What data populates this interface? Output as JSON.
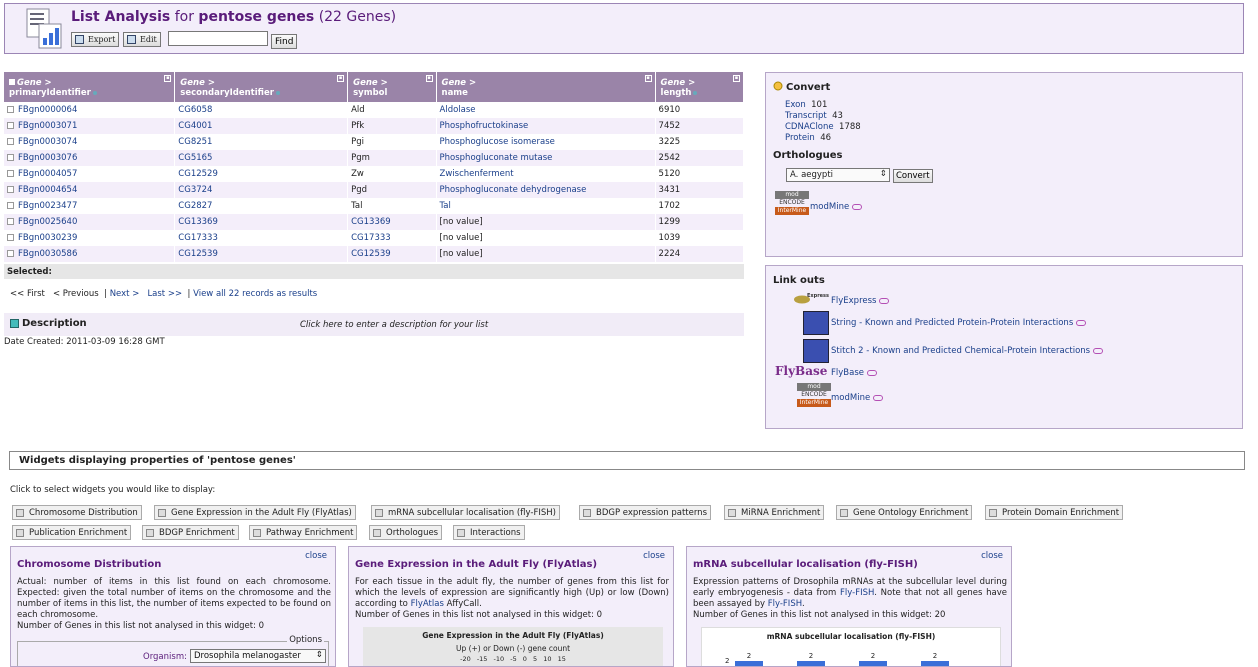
{
  "header": {
    "title_main": "List Analysis",
    "title_for": "for",
    "list_name": "pentose genes",
    "count": "(22 Genes)",
    "export_label": "Export",
    "edit_label": "Edit",
    "find_label": "Find",
    "find_value": ""
  },
  "table": {
    "columns": [
      {
        "cls": "Gene >",
        "field": "primaryIdentifier"
      },
      {
        "cls": "Gene >",
        "field": "secondaryIdentifier"
      },
      {
        "cls": "Gene >",
        "field": "symbol"
      },
      {
        "cls": "Gene >",
        "field": "name"
      },
      {
        "cls": "Gene >",
        "field": "length"
      }
    ],
    "rows": [
      [
        "FBgn0000064",
        "CG6058",
        "Ald",
        "Aldolase",
        "6910"
      ],
      [
        "FBgn0003071",
        "CG4001",
        "Pfk",
        "Phosphofructokinase",
        "7452"
      ],
      [
        "FBgn0003074",
        "CG8251",
        "Pgi",
        "Phosphoglucose isomerase",
        "3225"
      ],
      [
        "FBgn0003076",
        "CG5165",
        "Pgm",
        "Phosphogluconate mutase",
        "2542"
      ],
      [
        "FBgn0004057",
        "CG12529",
        "Zw",
        "Zwischenferment",
        "5120"
      ],
      [
        "FBgn0004654",
        "CG3724",
        "Pgd",
        "Phosphogluconate dehydrogenase",
        "3431"
      ],
      [
        "FBgn0023477",
        "CG2827",
        "Tal",
        "Tal",
        "1702"
      ],
      [
        "FBgn0025640",
        "CG13369",
        "CG13369",
        "[no value]",
        "1299"
      ],
      [
        "FBgn0030239",
        "CG17333",
        "CG17333",
        "[no value]",
        "1039"
      ],
      [
        "FBgn0030586",
        "CG12539",
        "CG12539",
        "[no value]",
        "2224"
      ]
    ],
    "selected_label": "Selected:"
  },
  "pager": {
    "first": "<< First",
    "previous": "< Previous",
    "next": "Next >",
    "last": "Last >>",
    "sep": "|",
    "view_all": "View all 22 records as results"
  },
  "description": {
    "label": "Description",
    "click": "Click here to enter a description for your list",
    "created": "Date Created: 2011-03-09 16:28 GMT"
  },
  "convert": {
    "title": "Convert",
    "items": [
      {
        "label": "Exon",
        "count": "101"
      },
      {
        "label": "Transcript",
        "count": "43"
      },
      {
        "label": "CDNAClone",
        "count": "1788"
      },
      {
        "label": "Protein",
        "count": "46"
      }
    ],
    "orthologues_title": "Orthologues",
    "organism": "A. aegypti",
    "convert_button": "Convert",
    "modmine": "modMine",
    "logo_mod": "mod",
    "logo_encode": "ENCODE",
    "logo_intermine": "InterMine"
  },
  "linkouts": {
    "title": "Link outs",
    "flyexpress": "FlyExpress",
    "flyexpress_logo": "Express",
    "string": "String - Known and Predicted Protein-Protein Interactions",
    "stitch": "Stitch 2 - Known and Predicted Chemical-Protein Interactions",
    "flybase_logo": "FlyBase",
    "flybase": "FlyBase",
    "modmine": "modMine"
  },
  "widgets": {
    "bar_title": "Widgets displaying properties of 'pentose genes'",
    "click_text": "Click to select widgets you would like to display:",
    "buttons": [
      "Chromosome Distribution",
      "Gene Expression in the Adult Fly (FlyAtlas)",
      "mRNA subcellular localisation (fly-FISH)",
      "BDGP expression patterns",
      "MiRNA Enrichment",
      "Gene Ontology Enrichment",
      "Protein Domain Enrichment",
      "Publication Enrichment",
      "BDGP Enrichment",
      "Pathway Enrichment",
      "Orthologues",
      "Interactions"
    ],
    "close_label": "close",
    "chromosome": {
      "title": "Chromosome Distribution",
      "desc": "Actual: number of items in this list found on each chromosome. Expected: given the total number of items on the chromosome and the number of items in this list, the number of items expected to be found on each chromosome.",
      "not_analysed": "Number of Genes in this list not analysed in this widget: 0",
      "options": "Options",
      "organism_label": "Organism:",
      "organism": "Drosophila melanogaster"
    },
    "flyatlas": {
      "title": "Gene Expression in the Adult Fly (FlyAtlas)",
      "desc_pre": "For each tissue in the adult fly, the number of genes from this list for which the levels of expression are significantly high (Up) or low (Down) according to",
      "desc_link": "FlyAtlas",
      "desc_post": "AffyCall.",
      "not_analysed": "Number of Genes in this list not analysed in this widget: 0",
      "chart_title": "Gene Expression in the Adult Fly (FlyAtlas)",
      "chart_sub": "Up (+) or Down (-) gene count",
      "ticks": [
        "-20",
        "-15",
        "-10",
        "-5",
        "0",
        "5",
        "10",
        "15"
      ]
    },
    "fish": {
      "title": "mRNA subcellular localisation (fly-FISH)",
      "desc_pre": "Expression patterns of Drosophila mRNAs at the subcellular level during early embryogenesis - data from",
      "desc_link1": "Fly-FISH",
      "desc_mid": ". Note that not all genes have been assayed by",
      "desc_link2": "Fly-FISH",
      "desc_end": ".",
      "not_analysed": "Number of Genes in this list not analysed in this widget: 20",
      "chart_title": "mRNA subcellular localisation (fly-FISH)",
      "y_tick": "2",
      "bar_values": [
        "2",
        "2",
        "2",
        "2"
      ]
    }
  },
  "colors": {
    "accent": "#5a1c7a",
    "header_bg": "#9a84a8",
    "panel_bg": "#f3eefa"
  }
}
